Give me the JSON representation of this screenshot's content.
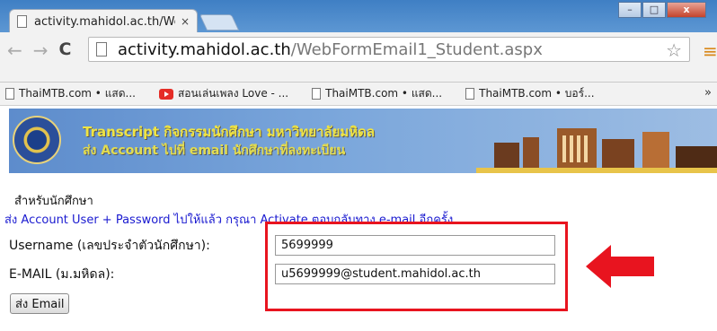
{
  "browser": {
    "tab_title": "activity.mahidol.ac.th/We",
    "tab_close": "×",
    "url_host": "activity.mahidol.ac.th",
    "url_path": "/WebFormEmail1_Student.aspx",
    "window_controls": {
      "minimize": "–",
      "maximize": "□",
      "close": "x"
    },
    "bookmarks": [
      {
        "label": "ThaiMTB.com • แสด...",
        "icon": "page-icon"
      },
      {
        "label": "สอนเล่นเพลง Love - ...",
        "icon": "youtube-icon"
      },
      {
        "label": "ThaiMTB.com • แสด...",
        "icon": "page-icon"
      },
      {
        "label": "ThaiMTB.com • บอร์...",
        "icon": "page-icon"
      }
    ],
    "bookmarks_more": "»"
  },
  "banner": {
    "line1": "Transcript กิจกรรมนักศึกษา มหาวิทยาลัยมหิดล",
    "line2": "ส่ง Account ไปที่ email นักศึกษาที่ลงทะเบียน"
  },
  "form": {
    "section_title": "สำหรับนักศึกษา",
    "info_text": "ส่ง Account User + Password ไปให้แล้ว กรุณา Activate ตอบกลับทาง e-mail อีกครั้ง",
    "username_label": "Username (เลขประจำตัวนักศึกษา):",
    "username_value": "5699999",
    "email_label": "E-MAIL (ม.มหิดล):",
    "email_value": "u5699999@student.mahidol.ac.th",
    "send_button": "ส่ง Email"
  },
  "colors": {
    "highlight": "#e8141f",
    "arrow": "#e8141f",
    "info_text": "#1a1ad0"
  }
}
